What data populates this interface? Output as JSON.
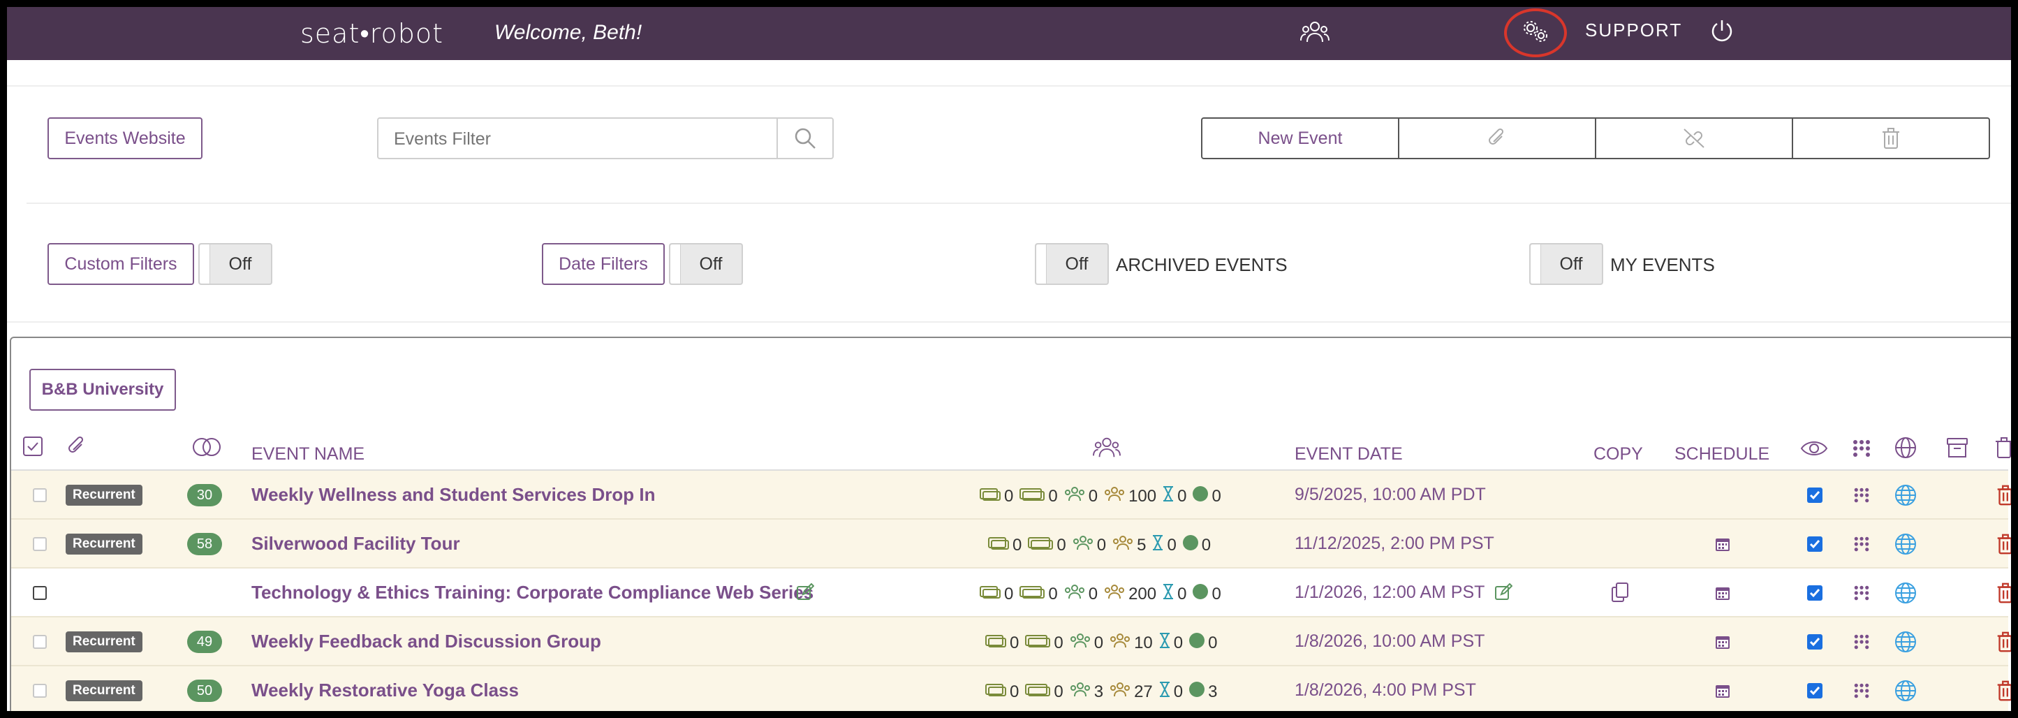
{
  "header": {
    "logo": "seat•robot",
    "welcome": "Welcome, Beth!",
    "support": "SUPPORT"
  },
  "toolbar": {
    "events_website": "Events Website",
    "filter_placeholder": "Events Filter",
    "new_event": "New Event"
  },
  "filters": {
    "custom_filters": "Custom Filters",
    "custom_filters_state": "Off",
    "date_filters": "Date Filters",
    "date_filters_state": "Off",
    "archived_state": "Off",
    "archived_label": "ARCHIVED EVENTS",
    "my_events_state": "Off",
    "my_events_label": "MY EVENTS"
  },
  "org_button": "B&B University",
  "columns": {
    "event_name": "EVENT NAME",
    "event_date": "EVENT DATE",
    "copy": "COPY",
    "schedule": "SCHEDULE"
  },
  "events": [
    {
      "recurrent": "Recurrent",
      "count": "30",
      "name": "Weekly Wellness and Student Services Drop In",
      "s1": "0",
      "s2": "0",
      "s3": "0",
      "s4": "100",
      "s5": "0",
      "s6": "0",
      "date": "9/5/2025, 10:00 AM PDT"
    },
    {
      "recurrent": "Recurrent",
      "count": "58",
      "name": "Silverwood Facility Tour",
      "s1": "0",
      "s2": "0",
      "s3": "0",
      "s4": "5",
      "s5": "0",
      "s6": "0",
      "date": "11/12/2025, 2:00 PM PST"
    },
    {
      "recurrent": "",
      "count": "",
      "name": "Technology & Ethics Training: Corporate Compliance Web Series",
      "s1": "0",
      "s2": "0",
      "s3": "0",
      "s4": "200",
      "s5": "0",
      "s6": "0",
      "date": "1/1/2026, 12:00 AM PST"
    },
    {
      "recurrent": "Recurrent",
      "count": "49",
      "name": "Weekly Feedback and Discussion Group",
      "s1": "0",
      "s2": "0",
      "s3": "0",
      "s4": "10",
      "s5": "0",
      "s6": "0",
      "date": "1/8/2026, 10:00 AM PST"
    },
    {
      "recurrent": "Recurrent",
      "count": "50",
      "name": "Weekly Restorative Yoga Class",
      "s1": "0",
      "s2": "0",
      "s3": "3",
      "s4": "27",
      "s5": "0",
      "s6": "3",
      "date": "1/8/2026, 4:00 PM PST"
    }
  ],
  "icons": {
    "accent": "#7a4f8a",
    "header_bg": "#4a3550",
    "highlight_circle": "#d9362b"
  }
}
